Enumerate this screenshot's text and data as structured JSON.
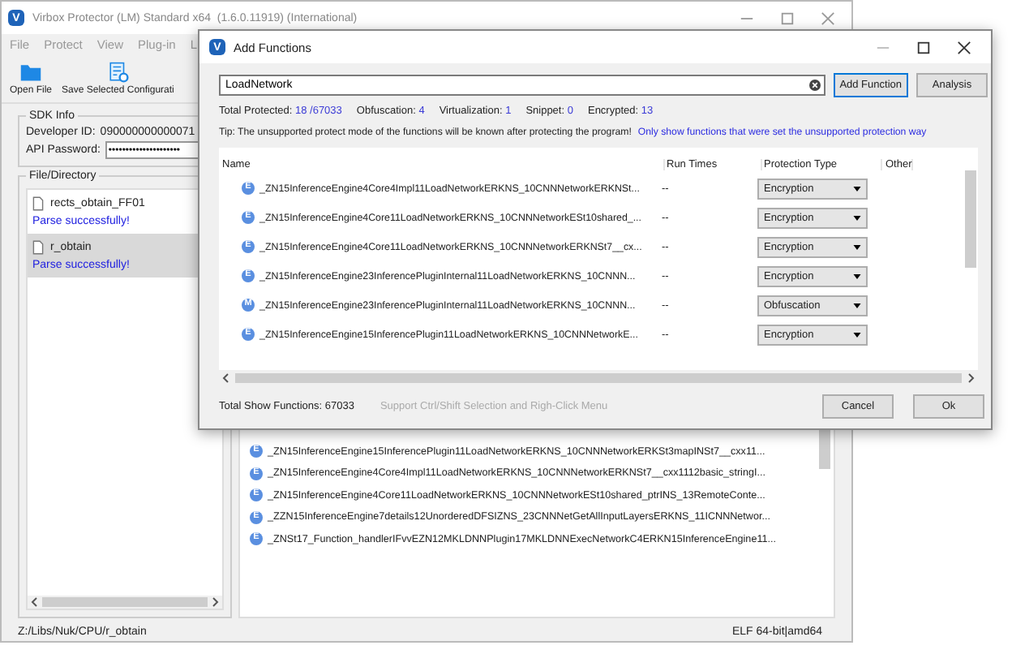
{
  "main_window": {
    "logo": "V",
    "title": "Virbox Protector (LM) Standard x64  (1.6.0.11919) (International)",
    "menu": [
      "File",
      "Protect",
      "View",
      "Plug-in",
      "L"
    ],
    "toolbar": [
      {
        "kind": "open",
        "label": "Open File"
      },
      {
        "kind": "save",
        "label": "Save Selected Configurati"
      }
    ],
    "sdk_info": {
      "title": "SDK Info",
      "developer_id_label": "Developer ID:",
      "developer_id": "090000000000071",
      "api_password_label": "API Password:",
      "api_password": "•••••••••••••••••••••"
    },
    "files": {
      "title": "File/Directory",
      "items": [
        {
          "name": "rects_obtain_FF01",
          "status": "Parse successfully!",
          "selected": false
        },
        {
          "name": "r_obtain",
          "status": "Parse successfully!",
          "selected": true
        }
      ]
    },
    "functions": [
      {
        "badge": "E",
        "name": "_ZN15InferenceEngine15InferencePlugin11LoadNetworkERKNS_10CNNNetworkERKSt3mapINSt7__cxx11..."
      },
      {
        "badge": "E",
        "name": "_ZN15InferenceEngine4Core4Impl11LoadNetworkERKNS_10CNNNetworkERKNSt7__cxx1112basic_stringI..."
      },
      {
        "badge": "E",
        "name": "_ZN15InferenceEngine4Core11LoadNetworkERKNS_10CNNNetworkESt10shared_ptrINS_13RemoteConte..."
      },
      {
        "badge": "E",
        "name": "_ZZN15InferenceEngine7details12UnorderedDFSIZNS_23CNNNetGetAllInputLayersERKNS_11ICNNNetwor..."
      },
      {
        "badge": "E",
        "name": "_ZNSt17_Function_handlerIFvvEZN12MKLDNNPlugin17MKLDNNExecNetworkC4ERKN15InferenceEngine11..."
      }
    ],
    "status_bar": {
      "path": "Z:/Libs/Nuk/CPU/r_obtain",
      "format": "ELF 64-bit|amd64"
    }
  },
  "dialog": {
    "logo": "V",
    "title": "Add Functions",
    "search": {
      "value": "LoadNetwork"
    },
    "buttons": [
      {
        "label": "Add Function",
        "focused": true
      },
      {
        "label": "Analysis",
        "focused": false
      }
    ],
    "stats": [
      {
        "label": "Total Protected:",
        "value": "18 /67033"
      },
      {
        "label": "Obfuscation:",
        "value": "4"
      },
      {
        "label": "Virtualization:",
        "value": "1"
      },
      {
        "label": "Snippet:",
        "value": "0"
      },
      {
        "label": "Encrypted:",
        "value": "13"
      }
    ],
    "tip": "Tip: The unsupported protect mode of the functions will be known after protecting the program!",
    "tip_link": "Only show functions that were set the unsupported protection way",
    "table": {
      "columns": [
        "Name",
        "Run Times",
        "Protection Type",
        "Other"
      ],
      "rows": [
        {
          "badge": "E",
          "name": "_ZN15InferenceEngine4Core4Impl11LoadNetworkERKNS_10CNNNetworkERKNSt...",
          "run_times": "--",
          "protection": "Encryption"
        },
        {
          "badge": "E",
          "name": "_ZN15InferenceEngine4Core11LoadNetworkERKNS_10CNNNetworkESt10shared_...",
          "run_times": "--",
          "protection": "Encryption"
        },
        {
          "badge": "E",
          "name": "_ZN15InferenceEngine4Core11LoadNetworkERKNS_10CNNNetworkERKNSt7__cx...",
          "run_times": "--",
          "protection": "Encryption"
        },
        {
          "badge": "E",
          "name": "_ZN15InferenceEngine23InferencePluginInternal11LoadNetworkERKNS_10CNNN...",
          "run_times": "--",
          "protection": "Encryption"
        },
        {
          "badge": "M",
          "name": "_ZN15InferenceEngine23InferencePluginInternal11LoadNetworkERKNS_10CNNN...",
          "run_times": "--",
          "protection": "Obfuscation"
        },
        {
          "badge": "E",
          "name": "_ZN15InferenceEngine15InferencePlugin11LoadNetworkERKNS_10CNNNetworkE...",
          "run_times": "--",
          "protection": "Encryption"
        }
      ]
    },
    "total_shown": "Total Show Functions: 67033",
    "hint": "Support Ctrl/Shift Selection and Righ-Click Menu",
    "footer_buttons": [
      "Cancel",
      "Ok"
    ]
  }
}
